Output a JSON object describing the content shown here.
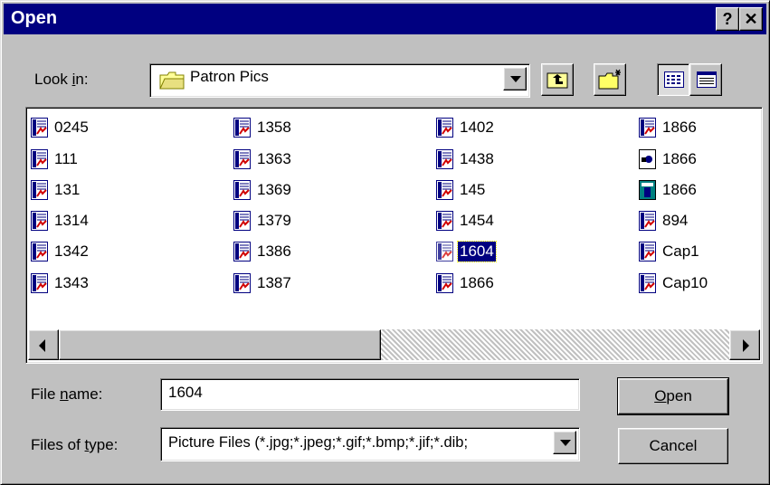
{
  "window": {
    "title": "Open",
    "help_label": "?",
    "close_label": "✕"
  },
  "look_in": {
    "label_pre": "Look ",
    "label_key": "i",
    "label_post": "n:",
    "value": "Patron Pics"
  },
  "toolbar": {
    "up_icon": "up-folder-icon",
    "new_folder_icon": "new-folder-icon",
    "list_icon": "list-view-icon",
    "details_icon": "details-view-icon"
  },
  "files": [
    {
      "name": "0245",
      "icon": "image-file-icon",
      "selected": false
    },
    {
      "name": "111",
      "icon": "image-file-icon",
      "selected": false
    },
    {
      "name": "131",
      "icon": "image-file-icon",
      "selected": false
    },
    {
      "name": "1314",
      "icon": "image-file-icon",
      "selected": false
    },
    {
      "name": "1342",
      "icon": "image-file-icon",
      "selected": false
    },
    {
      "name": "1343",
      "icon": "image-file-icon",
      "selected": false
    },
    {
      "name": "1358",
      "icon": "image-file-icon",
      "selected": false
    },
    {
      "name": "1363",
      "icon": "image-file-icon",
      "selected": false
    },
    {
      "name": "1369",
      "icon": "image-file-icon",
      "selected": false
    },
    {
      "name": "1379",
      "icon": "image-file-icon",
      "selected": false
    },
    {
      "name": "1386",
      "icon": "image-file-icon",
      "selected": false
    },
    {
      "name": "1387",
      "icon": "image-file-icon",
      "selected": false
    },
    {
      "name": "1402",
      "icon": "image-file-icon",
      "selected": false
    },
    {
      "name": "1438",
      "icon": "image-file-icon",
      "selected": false
    },
    {
      "name": "145",
      "icon": "image-file-icon",
      "selected": false
    },
    {
      "name": "1454",
      "icon": "image-file-icon",
      "selected": false
    },
    {
      "name": "1604",
      "icon": "image-file-icon",
      "selected": true
    },
    {
      "name": "1866",
      "icon": "image-file-icon",
      "selected": false
    },
    {
      "name": "1866",
      "icon": "image-file-icon",
      "selected": false
    },
    {
      "name": "1866",
      "icon": "photo-file-icon",
      "selected": false
    },
    {
      "name": "1866",
      "icon": "graphic-file-icon",
      "selected": false
    },
    {
      "name": "894",
      "icon": "image-file-icon",
      "selected": false
    },
    {
      "name": "Cap1",
      "icon": "image-file-icon",
      "selected": false
    },
    {
      "name": "Cap10",
      "icon": "image-file-icon",
      "selected": false
    }
  ],
  "file_name": {
    "label_pre": "File ",
    "label_key": "n",
    "label_post": "ame:",
    "value": "1604"
  },
  "file_type": {
    "label_pre": "Files of ",
    "label_key": "t",
    "label_post": "ype:",
    "value": "Picture Files (*.jpg;*.jpeg;*.gif;*.bmp;*.jif;*.dib;"
  },
  "buttons": {
    "open_key": "O",
    "open_rest": "pen",
    "cancel": "Cancel"
  }
}
